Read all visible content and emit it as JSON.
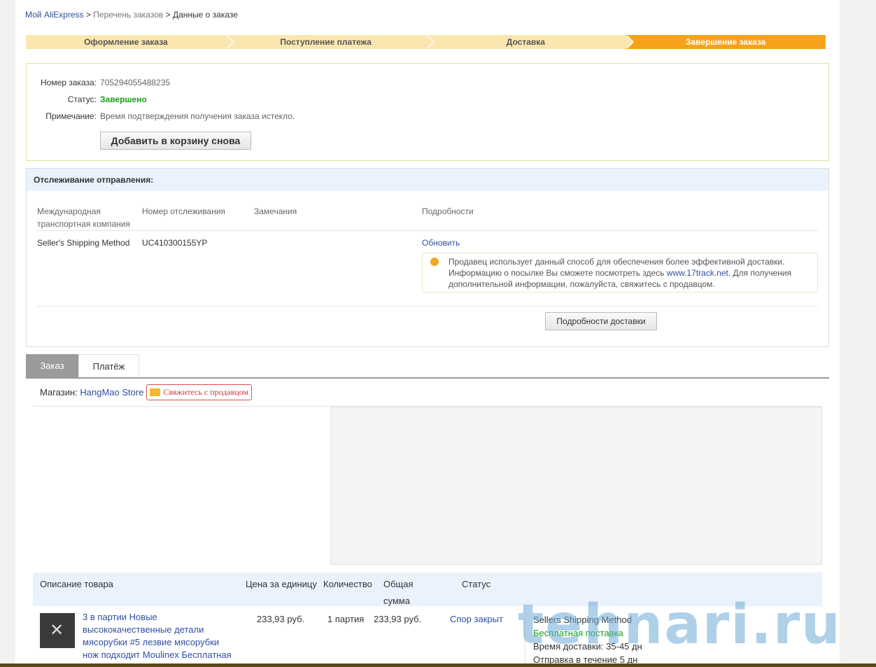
{
  "breadcrumb": {
    "home": "Мой AliExpress",
    "list": "Перечень заказов",
    "current": "Данные о заказе",
    "sep": ">"
  },
  "steps": [
    "Оформление заказа",
    "Поступление платежа",
    "Доставка",
    "Завершение заказа"
  ],
  "order": {
    "number_label": "Номер заказа:",
    "number": "705294055488235",
    "status_label": "Статус:",
    "status": "Завершено",
    "note_label": "Примечание:",
    "note": "Время подтверждения получения заказа истекло.",
    "reorder_button": "Добавить в корзину снова"
  },
  "tracking": {
    "title": "Отслеживание отправления:",
    "headers": [
      "Международная транспортная компания",
      "Номер отслеживания",
      "Замечания",
      "Подробности"
    ],
    "carrier": "Seller's Shipping Method",
    "tracking_number": "UC410300155YP",
    "refresh": "Обновить",
    "info_1": "Продавец использует данный способ для обеспечения более эффективной доставки. Информацию о посылке Вы сможете посмотреть здесь ",
    "info_link": "www.17track.net",
    "info_2": ". Для получения дополнительной информации, пожалуйста, свяжитесь с продавцом.",
    "details_button": "Подробности доставки"
  },
  "tabs": [
    "Заказ",
    "Платёж"
  ],
  "shop": {
    "label": "Магазин:",
    "name": "HangMao Store",
    "contact": "Свяжитесь с продавцом"
  },
  "table": {
    "headers": [
      "Описание товара",
      "Цена за единицу",
      "Количество",
      "Общая сумма",
      "Статус"
    ],
    "rows": [
      {
        "title": "3 в партии Новые высококачественные детали мясорубки #5 лезвие мясорубки нож подходит Moulinex Бесплатная",
        "price": "233,93 руб.",
        "qty": "1 партия",
        "total": "233,93 руб.",
        "status": "Спор закрыт",
        "shipping": "Sellers Shipping Method",
        "free": "Бесплатная поставка",
        "delivery": "Время доставки: 35-45 дн",
        "dispatch": "Отправка в течение 5 дн"
      }
    ]
  },
  "watermark": "tehnari.ru"
}
